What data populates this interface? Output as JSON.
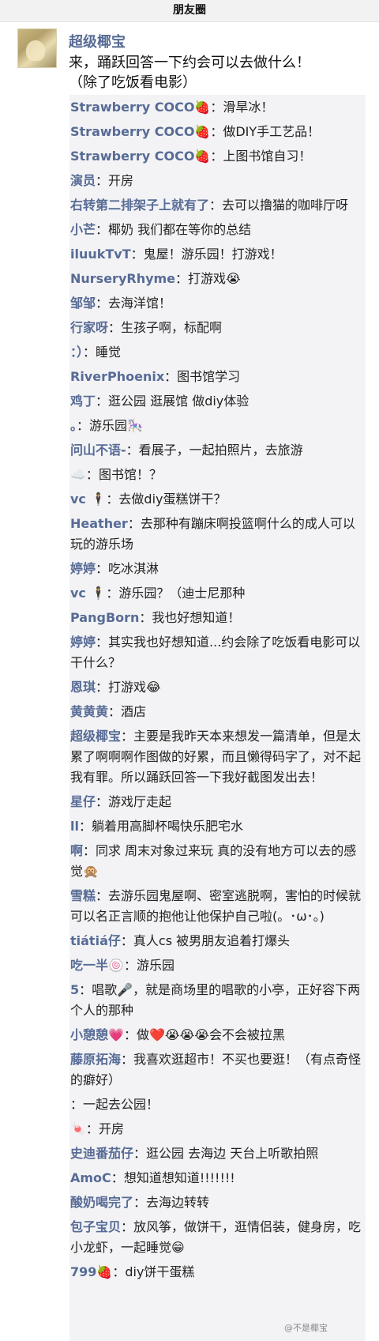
{
  "header": {
    "title": "朋友圈"
  },
  "post": {
    "author": "超级椰宝",
    "text": "来，踊跃回答一下约会可以去做什么！\n（除了吃饭看电影）"
  },
  "comments": [
    {
      "name": "Strawberry COCO🍓",
      "text": "滑旱冰！"
    },
    {
      "name": "Strawberry COCO🍓",
      "text": "做DIY手工艺品！"
    },
    {
      "name": "Strawberry COCO🍓",
      "text": "上图书馆自习！"
    },
    {
      "name": "演员",
      "text": "开房"
    },
    {
      "name": "右转第二排架子上就有了",
      "text": "去可以撸猫的咖啡厅呀"
    },
    {
      "name": "小芒",
      "text": "椰奶 我们都在等你的总结"
    },
    {
      "name": "iluukTvT",
      "text": "鬼屋！游乐园！打游戏！"
    },
    {
      "name": "NurseryRhyme",
      "text": "打游戏😭"
    },
    {
      "name": "邹邹",
      "text": "去海洋馆！"
    },
    {
      "name": "行家呀",
      "text": "生孩子啊，标配啊"
    },
    {
      "name": "：）",
      "text": "睡觉"
    },
    {
      "name": "RiverPhoenix",
      "text": "图书馆学习"
    },
    {
      "name": "鸡丁",
      "text": "逛公园 逛展馆 做diy体验"
    },
    {
      "name": "。",
      "text": "游乐园🎠"
    },
    {
      "name": "问山不语-",
      "text": "看展子，一起拍照片，去旅游"
    },
    {
      "name": "☁️",
      "text": "图书馆！？"
    },
    {
      "name": "vc 🕴",
      "text": "去做diy蛋糕饼干？"
    },
    {
      "name": "Heather",
      "text": "去那种有蹦床啊投篮啊什么的成人可以玩的游乐场"
    },
    {
      "name": "婷婷",
      "text": "吃冰淇淋"
    },
    {
      "name": "vc 🕴",
      "text": "游乐园？（迪士尼那种"
    },
    {
      "name": "PangBorn",
      "text": "我也好想知道！"
    },
    {
      "name": "婷婷",
      "text": "其实我也好想知道...约会除了吃饭看电影可以干什么？"
    },
    {
      "name": "恩琪",
      "text": "打游戏😂"
    },
    {
      "name": "黄黄黄",
      "text": "酒店"
    },
    {
      "name": "超级椰宝",
      "text": "主要是我昨天本来想发一篇清单，但是太累了啊啊啊作图做的好累，而且懒得码字了，对不起我有罪。所以踊跃回答一下我好截图发出去！"
    },
    {
      "name": "星仔",
      "text": "游戏厅走起"
    },
    {
      "name": "ll",
      "text": "躺着用高脚杯喝快乐肥宅水"
    },
    {
      "name": "啊",
      "text": "同求 周末对象过来玩 真的没有地方可以去的感觉🙊"
    },
    {
      "name": "雪糕",
      "text": "去游乐园鬼屋啊、密室逃脱啊，害怕的时候就可以名正言顺的抱他让他保护自己啦(。･ω･。)"
    },
    {
      "name": "tiátiá仔",
      "text": "真人cs 被男朋友追着打爆头"
    },
    {
      "name": "吃一半🍥",
      "text": "游乐园"
    },
    {
      "name": "5",
      "text": "唱歌🎤，就是商场里的唱歌的小亭，正好容下两个人的那种"
    },
    {
      "name": "小憩憩💗",
      "text": "做❤️😭😭😭会不会被拉黑"
    },
    {
      "name": "藤原拓海",
      "text": "我喜欢逛超市！不买也要逛！（有点奇怪的癖好）"
    },
    {
      "name": "",
      "text": "一起去公园！"
    },
    {
      "name": "🍬",
      "text": "开房"
    },
    {
      "name": "史迪番茄仔",
      "text": "逛公园 去海边  天台上听歌拍照"
    },
    {
      "name": "AmoC",
      "text": "想知道想知道!!!!!!!"
    },
    {
      "name": "酸奶喝完了",
      "text": "去海边转转"
    },
    {
      "name": "包子宝贝",
      "text": "放风筝，做饼干，逛情侣装，健身房，吃小龙虾，一起睡觉😁"
    },
    {
      "name": "799🍓",
      "text": "diy饼干蛋糕"
    }
  ],
  "watermark": "@不是椰宝"
}
